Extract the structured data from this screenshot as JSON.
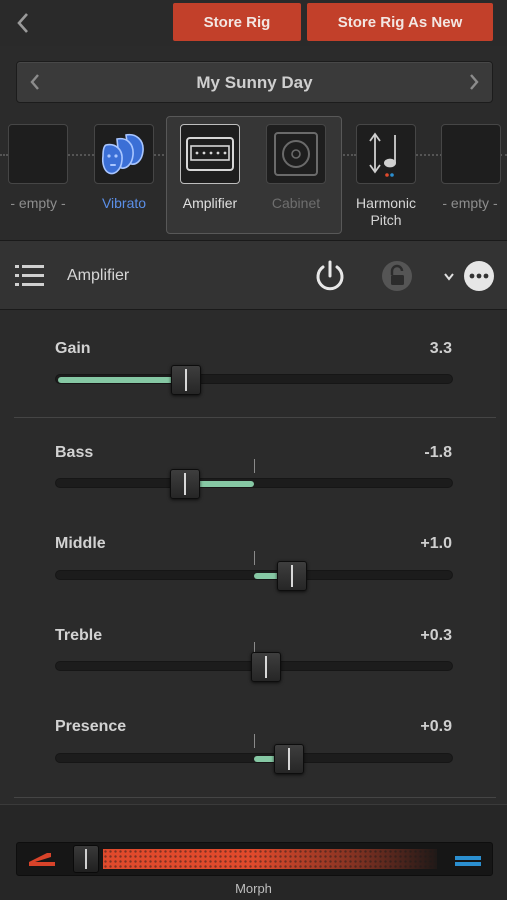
{
  "topbar": {
    "back_icon": "chevron-left-icon",
    "store_rig_label": "Store Rig",
    "store_rig_as_new_label": "Store Rig As New",
    "accent_color": "#c2402a"
  },
  "rig": {
    "name": "My Sunny Day",
    "prev_icon": "chevron-left-icon",
    "next_icon": "chevron-right-icon"
  },
  "chain": {
    "slots": [
      {
        "label": "- empty -",
        "icon": "empty-slot",
        "state": "empty"
      },
      {
        "label": "Vibrato",
        "icon": "vibrato-faces-icon",
        "state": "active",
        "color": "#5b8fe8"
      },
      {
        "label": "Amplifier",
        "icon": "amplifier-icon",
        "state": "selected"
      },
      {
        "label": "Cabinet",
        "icon": "cabinet-speaker-icon",
        "state": "disabled"
      },
      {
        "label": "Harmonic\nPitch",
        "icon": "pitch-note-icon",
        "state": "active"
      },
      {
        "label": "- empty -",
        "icon": "empty-slot",
        "state": "empty"
      }
    ]
  },
  "module": {
    "menu_icon": "list-menu-icon",
    "title": "Amplifier",
    "power_icon": "power-icon",
    "lock_icon": "lock-icon",
    "dropdown_icon": "chevron-down-icon",
    "more_icon": "more-dots-icon"
  },
  "params": [
    {
      "label": "Gain",
      "value": "3.3",
      "position": 0.33,
      "type": "unipolar"
    },
    {
      "label": "Bass",
      "value": "-1.8",
      "position": 0.32,
      "type": "bipolar"
    },
    {
      "label": "Middle",
      "value": "+1.0",
      "position": 0.59,
      "type": "bipolar"
    },
    {
      "label": "Treble",
      "value": "+0.3",
      "position": 0.53,
      "type": "bipolar"
    },
    {
      "label": "Presence",
      "value": "+0.9",
      "position": 0.58,
      "type": "bipolar"
    }
  ],
  "morph": {
    "label": "Morph",
    "left_pedal_icon": "pedal-left-icon",
    "right_pedal_icon": "pedal-right-icon",
    "left_color": "#d8432a",
    "right_color": "#2b8fd0",
    "position": 0.0
  },
  "colors": {
    "fill": "#86c8a4",
    "vibrato": "#5b8fe8"
  }
}
